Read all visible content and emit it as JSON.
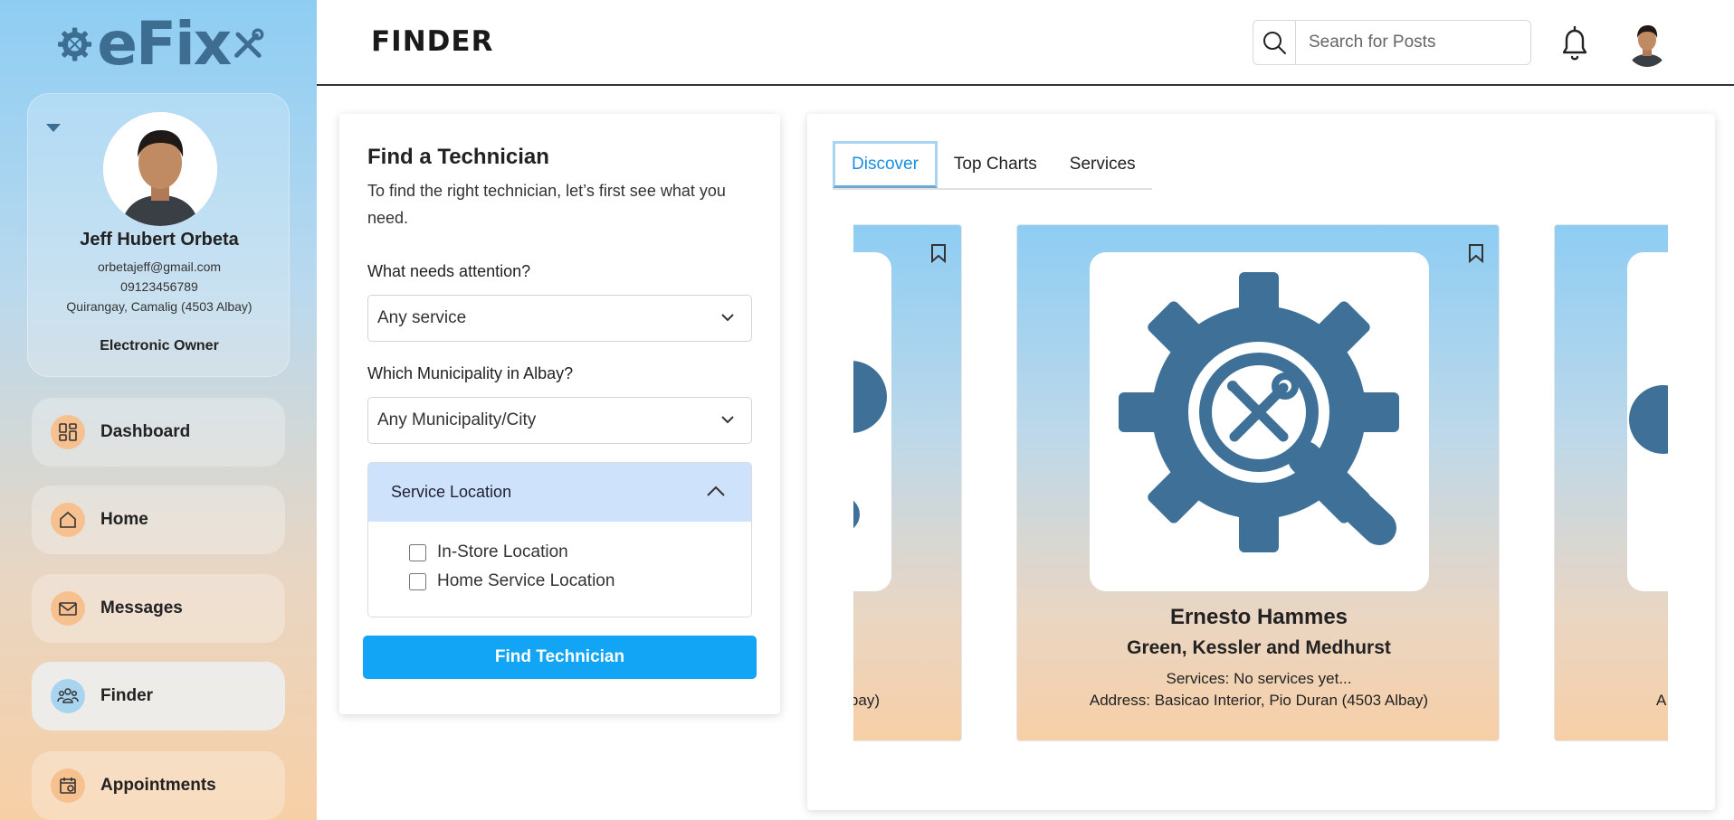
{
  "sidebar": {
    "logo_text": "eFix",
    "profile": {
      "name": "Jeff Hubert Orbeta",
      "email": "orbetajeff@gmail.com",
      "phone": "09123456789",
      "address": "Quirangay, Camalig (4503 Albay)",
      "role": "Electronic Owner"
    },
    "nav": [
      {
        "label": "Dashboard",
        "icon": "dashboard-icon"
      },
      {
        "label": "Home",
        "icon": "home-icon"
      },
      {
        "label": "Messages",
        "icon": "envelope-icon"
      },
      {
        "label": "Finder",
        "icon": "users-icon",
        "active": true
      },
      {
        "label": "Appointments",
        "icon": "calendar-icon"
      }
    ]
  },
  "header": {
    "title": "FINDER",
    "search_placeholder": "Search for Posts"
  },
  "form": {
    "title": "Find a Technician",
    "subtitle": "To find the right technician, let’s first see what you need.",
    "service_label": "What needs attention?",
    "service_value": "Any service",
    "municipality_label": "Which Municipality in Albay?",
    "municipality_value": "Any Municipality/City",
    "location_title": "Service Location",
    "location_options": [
      "In-Store Location",
      "Home Service Location"
    ],
    "submit_label": "Find Technician"
  },
  "results": {
    "tabs": [
      "Discover",
      "Top Charts",
      "Services"
    ],
    "active_tab": "Discover",
    "prev_card_address_fragment": "bay)",
    "next_card_address_fragment": "A",
    "featured": {
      "name": "Ernesto Hammes",
      "company": "Green, Kessler and Medhurst",
      "services": "Services: No services yet...",
      "address": "Address: Basicao Interior, Pio Duran (4503 Albay)"
    }
  },
  "colors": {
    "accent": "#12a4f5",
    "logo": "#3d6e92",
    "tab_active": "#1b8fe3",
    "accordion_header": "#cfe2fb"
  }
}
